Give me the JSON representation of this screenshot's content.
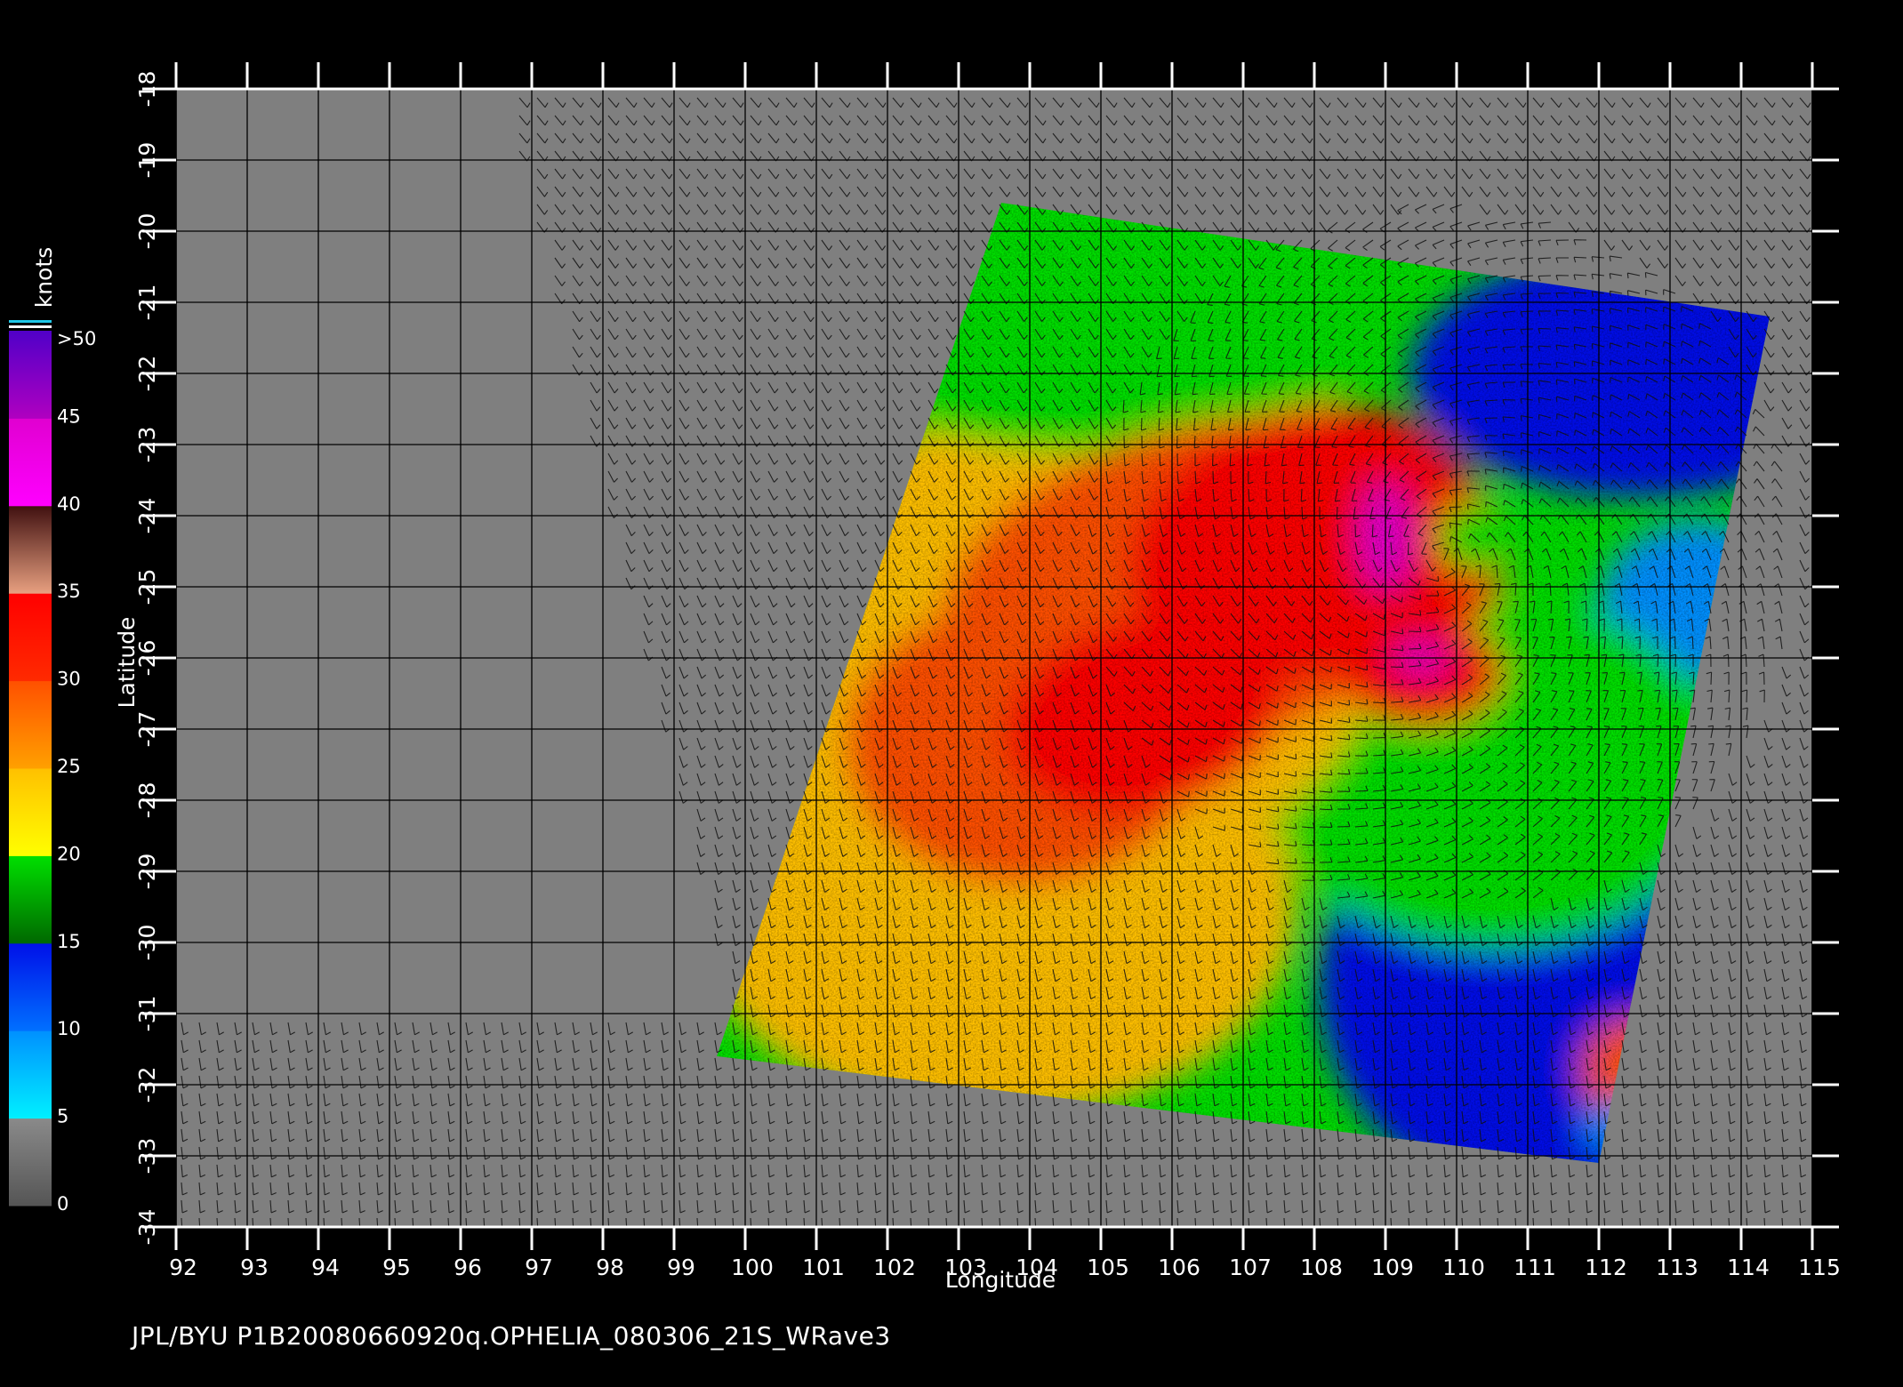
{
  "figure": {
    "caption": "JPL/BYU  P1B20080660920q.OPHELIA_080306_21S_WRave3",
    "x_axis": {
      "label": "Longitude",
      "ticks": [
        92,
        93,
        94,
        95,
        96,
        97,
        98,
        99,
        100,
        101,
        102,
        103,
        104,
        105,
        106,
        107,
        108,
        109,
        110,
        111,
        112,
        113,
        114,
        115
      ]
    },
    "y_axis": {
      "label": "Latitude",
      "ticks": [
        -18,
        -19,
        -20,
        -21,
        -22,
        -23,
        -24,
        -25,
        -26,
        -27,
        -28,
        -29,
        -30,
        -31,
        -32,
        -33,
        -34
      ]
    },
    "colorbar": {
      "title": "knots",
      "labels": [
        "0",
        "5",
        "10",
        "15",
        "20",
        "25",
        "30",
        "35",
        "40",
        "45",
        ">50"
      ],
      "bins": [
        {
          "from": 0,
          "to": 5,
          "color": "#555555",
          "color2": "#8a8a8a"
        },
        {
          "from": 5,
          "to": 10,
          "color": "#00f0ff",
          "color2": "#0090ff"
        },
        {
          "from": 10,
          "to": 15,
          "color": "#0070ff",
          "color2": "#0010e8"
        },
        {
          "from": 15,
          "to": 20,
          "color": "#006800",
          "color2": "#00e000"
        },
        {
          "from": 20,
          "to": 25,
          "color": "#ffff00",
          "color2": "#ffc000"
        },
        {
          "from": 25,
          "to": 30,
          "color": "#ffa000",
          "color2": "#ff5000"
        },
        {
          "from": 30,
          "to": 35,
          "color": "#ff2a00",
          "color2": "#ff0000"
        },
        {
          "from": 35,
          "to": 40,
          "color": "#e8a080",
          "color2": "#401010"
        },
        {
          "from": 40,
          "to": 45,
          "color": "#ff00ff",
          "color2": "#e000d0"
        },
        {
          "from": 45,
          "to": 50,
          "color": "#b000c0",
          "color2": "#5000c8"
        }
      ]
    },
    "colors": {
      "background": "#000000",
      "no_data": "#7f7f7f",
      "grid": "#000000",
      "text": "#ffffff"
    },
    "swath_corners": [
      {
        "lon": 103.6,
        "lat": -19.6
      },
      {
        "lon": 114.4,
        "lat": -21.2
      },
      {
        "lon": 112.0,
        "lat": -33.1
      },
      {
        "lon": 99.6,
        "lat": -31.6
      }
    ],
    "storm_center": {
      "lon": 109.8,
      "lat": -24.6
    }
  }
}
